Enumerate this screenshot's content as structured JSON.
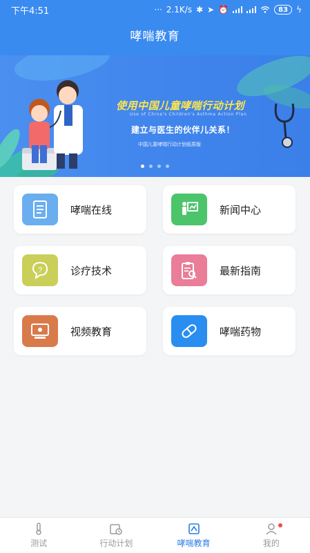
{
  "status": {
    "time": "下午4:51",
    "speed": "2.1K/s",
    "battery": "83"
  },
  "header": {
    "title": "哮喘教育"
  },
  "banner": {
    "headline": "使用中国儿童哮喘行动计划",
    "subtitle_en": "Use of China's Children's Asthma Action Plan",
    "tagline": "建立与医生的伙伴儿关系！",
    "caption": "中国儿童哮喘行动计划纸质版",
    "dots": 4,
    "active_dot": 0
  },
  "menu": [
    {
      "label": "哮喘在线",
      "icon": "book-icon",
      "color": "#6aaef0"
    },
    {
      "label": "新闻中心",
      "icon": "news-board-icon",
      "color": "#4cc46a"
    },
    {
      "label": "诊疗技术",
      "icon": "question-bubble-icon",
      "color": "#c9cf58"
    },
    {
      "label": "最新指南",
      "icon": "clipboard-search-icon",
      "color": "#ea7d97"
    },
    {
      "label": "视频教育",
      "icon": "video-lesson-icon",
      "color": "#d97a4a"
    },
    {
      "label": "哮喘药物",
      "icon": "pill-icon",
      "color": "#2a8df0"
    }
  ],
  "tabs": [
    {
      "label": "测试",
      "icon": "thermometer-icon"
    },
    {
      "label": "行动计划",
      "icon": "calendar-clock-icon"
    },
    {
      "label": "哮喘教育",
      "icon": "education-icon"
    },
    {
      "label": "我的",
      "icon": "profile-icon"
    }
  ],
  "active_tab": 2,
  "colors": {
    "primary": "#3a8bf0",
    "tab_active": "#2c7be5",
    "badge": "#f24b4b"
  }
}
